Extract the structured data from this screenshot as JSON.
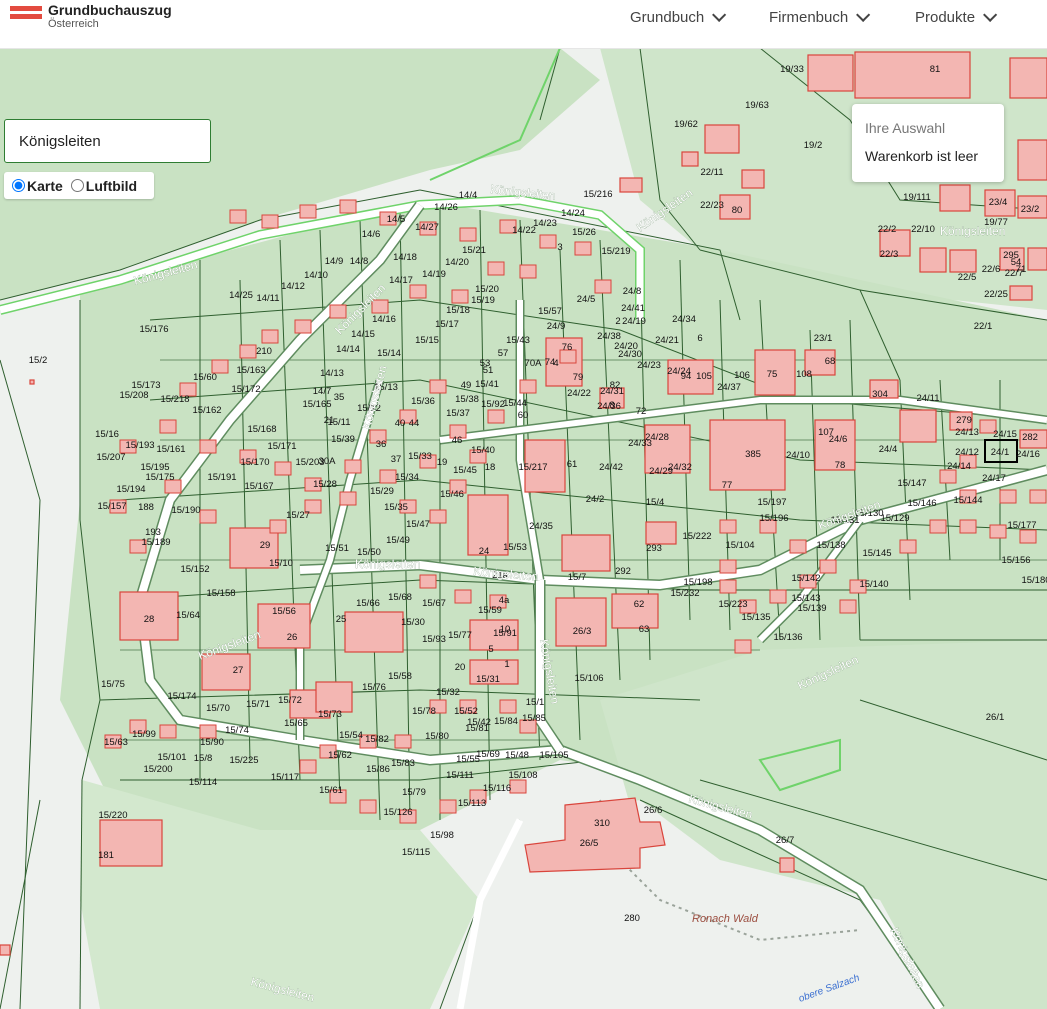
{
  "header": {
    "brand_title": "Grundbuchauszug",
    "brand_subtitle": "Österreich",
    "nav": [
      {
        "label": "Grundbuch"
      },
      {
        "label": "Firmenbuch"
      },
      {
        "label": "Produkte"
      }
    ]
  },
  "search": {
    "value": "Königsleiten"
  },
  "layers": {
    "karte": "Karte",
    "luftbild": "Luftbild",
    "selected": "Karte"
  },
  "cart": {
    "heading": "Ihre Auswahl",
    "empty": "Warenkorb ist leer"
  },
  "map": {
    "colors": {
      "green_area": "#c9e2c3",
      "light_area": "#f1f3f1",
      "boundary": "#2f5f2f",
      "building": "#f3b6b2",
      "building_border": "#d9453c",
      "road_edge": "#6fd36a"
    },
    "road_labels": [
      "Königsleiten",
      "Königsleiten",
      "Königsleiten",
      "Königsleiten",
      "Königsleiten",
      "Königsleiten",
      "Königsleiten",
      "Königsleiten",
      "Königsleiten",
      "Königsleiten",
      "Königsleiten",
      "Königsleiten",
      "Königsleiten",
      "Königsleiten",
      "Königsleiten"
    ],
    "place_labels": [
      "Ronach Wald",
      "obere Salzach"
    ],
    "parcel_labels": [
      "19/33",
      "81",
      "19/63",
      "19/62",
      "19/2",
      "22/11",
      "22/23",
      "80",
      "19/111",
      "19/77",
      "22/2",
      "22/3",
      "22/10",
      "22/6",
      "22/7",
      "22/5",
      "22/25",
      "22/1",
      "14/4",
      "15/216",
      "14/26",
      "14/5",
      "14/27",
      "14/24",
      "15/26",
      "14/6",
      "14/23",
      "14/22",
      "15/219",
      "24/5",
      "24/8",
      "14/25",
      "14/11",
      "15/176",
      "15/57",
      "24/9",
      "24/34",
      "24/41",
      "24/19",
      "15/2",
      "15/60",
      "15/163",
      "24/38",
      "24/20",
      "24/30",
      "24/21",
      "23/1",
      "15/173",
      "15/208",
      "15/218",
      "15/162",
      "210",
      "75",
      "304",
      "24/11",
      "279",
      "24/13",
      "24/15",
      "282",
      "15/16",
      "15/168",
      "15/170",
      "15/191",
      "15/194",
      "15/195",
      "15/161",
      "15/157",
      "15/190",
      "188",
      "15/189",
      "193",
      "29",
      "28",
      "26",
      "27",
      "25",
      "24",
      "15/217",
      "61",
      "24/42",
      "24/29",
      "24/33",
      "24/28",
      "24/32",
      "385",
      "77",
      "24/6",
      "78",
      "24/4",
      "24/12",
      "24/14",
      "24/1",
      "24/16",
      "24/17",
      "15/147",
      "15/144",
      "15/146",
      "15/145",
      "15/140",
      "15/156",
      "15/180",
      "15/177",
      "15/152",
      "15/158",
      "15/56",
      "15/64",
      "15/66",
      "15/67",
      "15/59",
      "15/30",
      "15/93",
      "15/77",
      "15/91",
      "5",
      "15/31",
      "15/32",
      "15/58",
      "15/76",
      "15/75",
      "15/174",
      "15/70",
      "15/71",
      "15/72",
      "15/73",
      "15/74",
      "15/90",
      "15/63",
      "15/99",
      "15/200",
      "15/101",
      "15/8",
      "15/225",
      "15/117",
      "15/61",
      "15/62",
      "15/78",
      "15/80",
      "15/81",
      "15/84",
      "15/85",
      "15/86",
      "15/83",
      "15/82",
      "15/79",
      "15/111",
      "15/113",
      "15/116",
      "15/108",
      "15/105",
      "15/126",
      "15/98",
      "15/115",
      "15/114",
      "15/220",
      "181",
      "26/5",
      "310",
      "26/6",
      "26/7",
      "280",
      "26/1",
      "26/3",
      "62",
      "63",
      "15/106",
      "15/7",
      "292",
      "293",
      "15/222",
      "15/4",
      "24/2",
      "24/35",
      "15/53",
      "15/104",
      "15/197",
      "15/196",
      "15/198",
      "15/232",
      "15/223",
      "15/135",
      "15/136",
      "15/143",
      "15/139",
      "15/142",
      "15/138",
      "15/131",
      "15/130",
      "15/129",
      "24/10",
      "24/24",
      "24/37",
      "24/23",
      "24/36",
      "24/22",
      "24/31",
      "72",
      "15/92",
      "15/44",
      "15/43",
      "15/41",
      "15/40",
      "15/45",
      "15/46",
      "15/47",
      "15/49",
      "15/50",
      "15/51",
      "15/10",
      "15/27",
      "15/28",
      "15/29",
      "15/34",
      "15/35",
      "15/33",
      "15/36",
      "15/37",
      "15/38",
      "15/39",
      "15/11",
      "15/12",
      "15/13",
      "15/14",
      "15/15",
      "15/17",
      "15/18",
      "15/19",
      "15/20",
      "15/21",
      "14/20",
      "14/19",
      "14/18",
      "14/17",
      "14/16",
      "14/15",
      "14/14",
      "14/13",
      "14/12",
      "14/10",
      "14/9",
      "14/8",
      "14/7",
      "15/165",
      "15/167",
      "15/171",
      "15/172",
      "15/175",
      "15/193",
      "15/207",
      "15/203",
      "30A",
      "21",
      "35",
      "36",
      "37",
      "40",
      "44",
      "46",
      "49",
      "51",
      "53",
      "57",
      "60",
      "70A",
      "74",
      "76",
      "79",
      "82",
      "94",
      "105",
      "106",
      "107",
      "108",
      "23/4",
      "23/2",
      "295",
      "54",
      "71",
      "68",
      "4",
      "3",
      "2",
      "6",
      "8",
      "18",
      "19",
      "20",
      "21a",
      "4a",
      "10",
      "1",
      "15/1",
      "15/68",
      "15/69",
      "15/55",
      "15/48",
      "15/54",
      "15/65",
      "15/42",
      "15/52"
    ]
  }
}
